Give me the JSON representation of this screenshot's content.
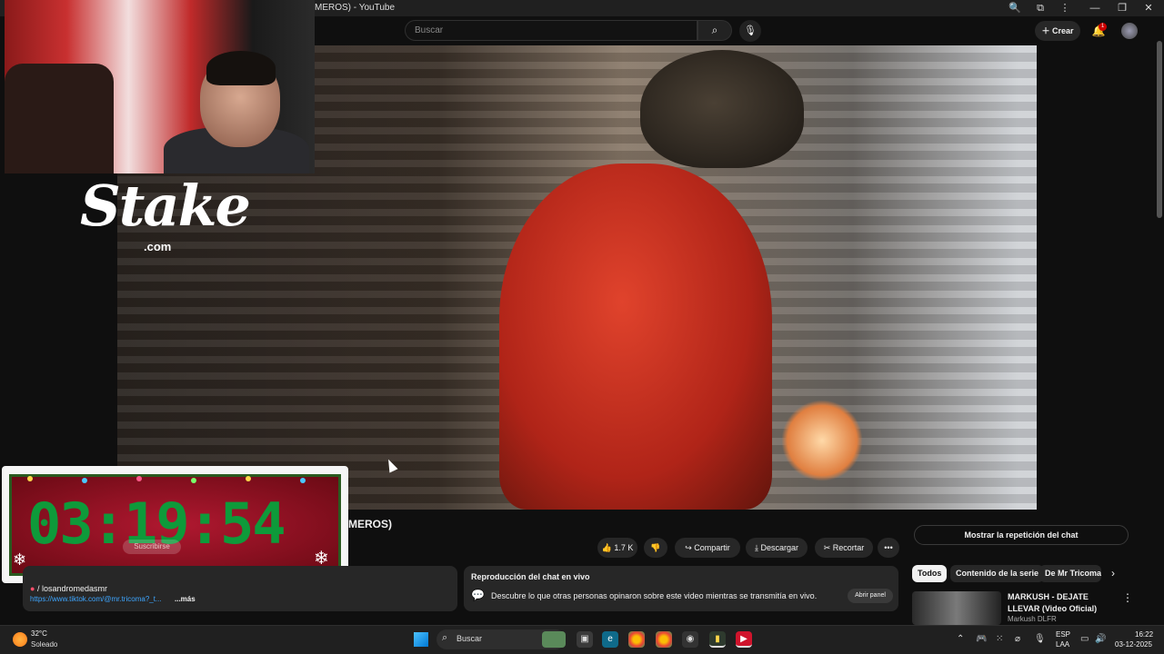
{
  "window": {
    "title": "MEROS) - YouTube",
    "controls": {
      "minimize": "—",
      "restore": "❐",
      "close": "✕",
      "menu": "⋮",
      "zoom": "🔍",
      "extension": "⧉"
    }
  },
  "header": {
    "search_placeholder": "Buscar",
    "create_label": "Crear",
    "notification_count": "1"
  },
  "overlay": {
    "stake_brand": "Stake",
    "stake_domain": ".com",
    "timer": "03:19:54",
    "subscribe_label": "Suscribirse"
  },
  "video": {
    "title_visible": "MEROS)",
    "actions": {
      "like_count": "1.7 K",
      "share_label": "Compartir",
      "download_label": "Descargar",
      "clip_label": "Recortar",
      "more_label": "•••"
    }
  },
  "description": {
    "channel_line": "/ losandromedasmr",
    "link_text": "https://www.tiktok.com/@mr.tricoma?_t...",
    "more_label": "...más"
  },
  "chat_replay": {
    "title": "Reproducción del chat en vivo",
    "description": "Descubre lo que otras personas opinaron sobre este video mientras se transmitía en vivo.",
    "open_panel_label": "Abrir panel",
    "show_replay_label": "Mostrar la repetición del chat"
  },
  "chips": [
    {
      "label": "Todos"
    },
    {
      "label": "Contenido de la serie"
    },
    {
      "label": "De Mr Tricoma"
    }
  ],
  "recommendation": {
    "title": "MARKUSH - DEJATE LLEVAR (Video Oficial)",
    "channel": "Markush DLFR"
  },
  "taskbar": {
    "temperature": "32°C",
    "weather": "Soleado",
    "search_label": "Buscar",
    "lang_1": "ESP",
    "lang_2": "LAA",
    "time": "16:22",
    "date": "03-12-2025"
  },
  "colors": {
    "background": "#0f0f0f",
    "timer_green": "#0e9a3a",
    "link_blue": "#3ea6ff",
    "badge_red": "#cc0000"
  }
}
